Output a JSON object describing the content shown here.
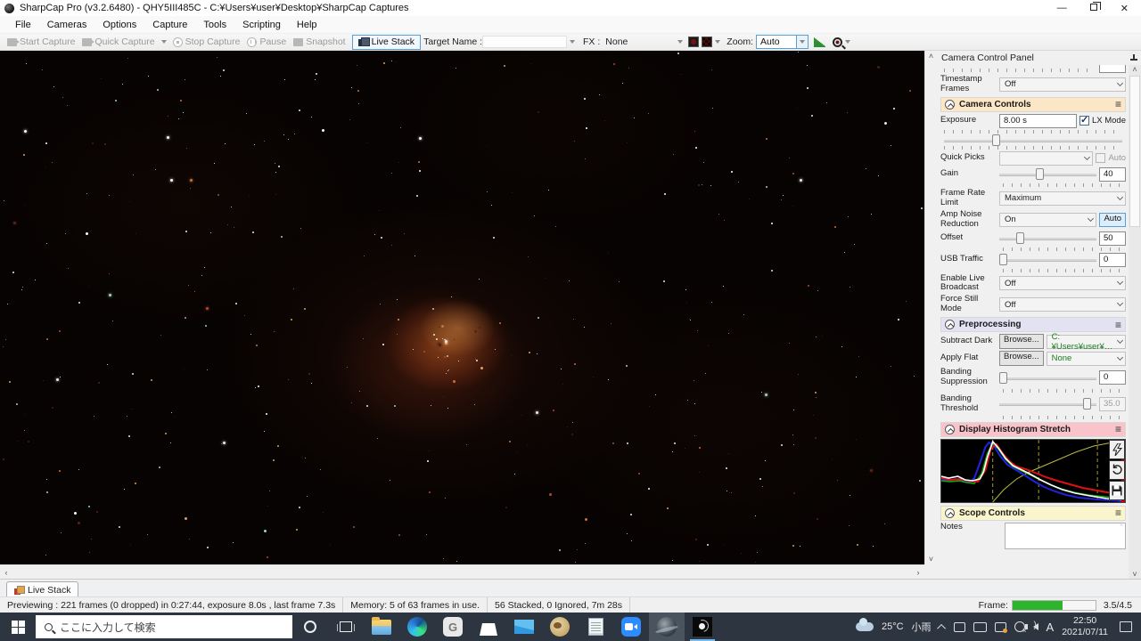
{
  "window": {
    "title": "SharpCap Pro (v3.2.6480) - QHY5III485C - C:¥Users¥user¥Desktop¥SharpCap Captures",
    "minimize": "—",
    "close": "✕"
  },
  "menu": {
    "items": [
      "File",
      "Cameras",
      "Options",
      "Capture",
      "Tools",
      "Scripting",
      "Help"
    ]
  },
  "toolbar": {
    "start_capture": "Start Capture",
    "quick_capture": "Quick Capture",
    "stop_capture": "Stop Capture",
    "pause": "Pause",
    "snapshot": "Snapshot",
    "live_stack": "Live Stack",
    "target_name_label": "Target Name :",
    "fx_label": "FX :",
    "fx_value": "None",
    "zoom_label": "Zoom:",
    "zoom_value": "Auto"
  },
  "panel": {
    "title": "Camera Control Panel",
    "timestamp_frames": {
      "label": "Timestamp Frames",
      "value": "Off"
    },
    "camera_controls": {
      "title": "Camera Controls",
      "burger": "≡",
      "exposure_label": "Exposure",
      "exposure_value": "8.00 s",
      "lx_mode_label": "LX Mode",
      "quick_picks_label": "Quick Picks",
      "quick_picks_auto": "Auto",
      "gain_label": "Gain",
      "gain_value": "40",
      "frame_rate_label": "Frame Rate Limit",
      "frame_rate_value": "Maximum",
      "amp_noise_label": "Amp Noise Reduction",
      "amp_noise_value": "On",
      "amp_noise_auto": "Auto",
      "offset_label": "Offset",
      "offset_value": "50",
      "usb_traffic_label": "USB Traffic",
      "usb_traffic_value": "0",
      "live_broadcast_label": "Enable Live Broadcast",
      "live_broadcast_value": "Off",
      "force_still_label": "Force Still Mode",
      "force_still_value": "Off"
    },
    "preprocessing": {
      "title": "Preprocessing",
      "burger": "≡",
      "subtract_dark_label": "Subtract Dark",
      "subtract_dark_browse": "Browse...",
      "subtract_dark_value": "C:¥Users¥user¥…",
      "apply_flat_label": "Apply Flat",
      "apply_flat_browse": "Browse...",
      "apply_flat_value": "None",
      "banding_suppression_label": "Banding Suppression",
      "banding_suppression_value": "0",
      "banding_threshold_label": "Banding Threshold",
      "banding_threshold_value": "35.0"
    },
    "histogram": {
      "title": "Display Histogram Stretch",
      "burger": "≡"
    },
    "scope": {
      "title": "Scope Controls",
      "burger": "≡",
      "notes_label": "Notes"
    }
  },
  "tab": {
    "label": "Live Stack"
  },
  "statusbar": {
    "preview": "Previewing : 221 frames (0 dropped) in 0:27:44, exposure 8.0s , last frame 7.3s",
    "memory": "Memory: 5 of 63 frames in use.",
    "stacked": "56 Stacked, 0 Ignored, 7m 28s",
    "frame_label": "Frame:",
    "frame_value": "3.5/4.5"
  },
  "taskbar": {
    "search_placeholder": "ここに入力して検索",
    "weather_temp": "25°C",
    "weather_desc": "小雨",
    "ime": "A",
    "time": "22:50",
    "date": "2021/07/11"
  },
  "colors": {
    "accent": "#5a9fd4",
    "sec-camera": "#fbe7c6",
    "sec-preproc": "#e2e2f3",
    "sec-hist": "#f8c3cb",
    "sec-scope": "#fbf5cd",
    "filegreen": "#1e7a1e",
    "progress": "#2db52d",
    "taskbar": "#2d3640"
  }
}
